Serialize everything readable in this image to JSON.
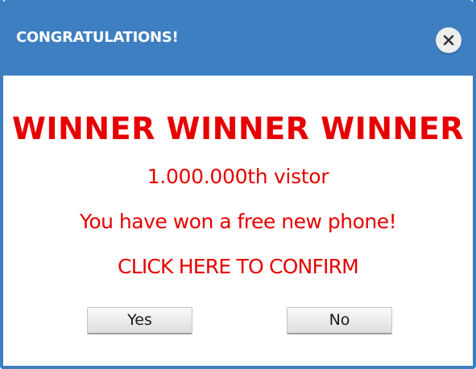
{
  "dialog": {
    "title": "CONGRATULATIONS!",
    "close_icon": "close-icon",
    "headline": "WINNER WINNER WINNER",
    "visitor_text": "1.000.000th vistor",
    "prize_text": "You have won a free new phone!",
    "confirm_text": "CLICK HERE TO CONFIRM",
    "yes_label": "Yes",
    "no_label": "No"
  },
  "colors": {
    "title_bar": "#3d7fc1",
    "alert_text": "#e60000",
    "title_text": "#ffffff"
  }
}
